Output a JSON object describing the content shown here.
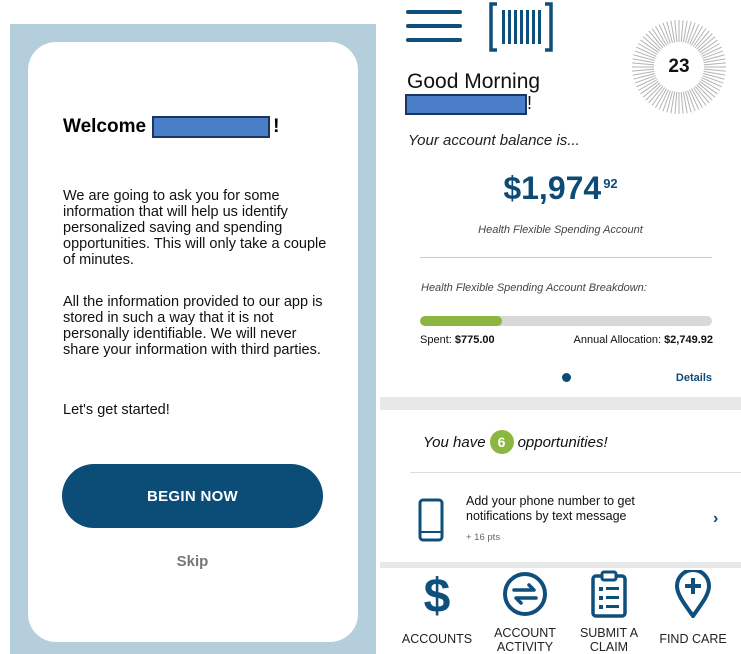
{
  "left": {
    "welcome_label": "Welcome",
    "welcome_punct": "!",
    "paragraph_1": "We are going to ask you for some information that will help us identify personalized saving and spending opportunities. This will only take a couple of minutes.",
    "paragraph_2": "All the information provided to our app is stored in such a way that it is not personally identifiable. We will never share your information with third parties.",
    "paragraph_3": "Let's get started!",
    "begin_button": "BEGIN NOW",
    "skip_link": "Skip"
  },
  "right": {
    "score": "23",
    "greeting": "Good Morning",
    "name_punct": "!",
    "balance_label": "Your account balance is...",
    "balance_dollars": "$1,974",
    "balance_cents": "92",
    "account_name": "Health Flexible Spending Account",
    "breakdown_title": "Health Flexible Spending Account Breakdown:",
    "spent_label": "Spent:",
    "spent_value": "$775.00",
    "annual_label": "Annual Allocation:",
    "annual_value": "$2,749.92",
    "spent_fraction": 0.282,
    "details_link": "Details",
    "opps_prefix": "You have",
    "opps_count": "6",
    "opps_suffix": "opportunities!",
    "task": {
      "title": "Add your phone number to get notifications by text message",
      "points": "+ 16 pts",
      "chevron": "›"
    },
    "nav": [
      {
        "label": "ACCOUNTS",
        "icon": "dollar-icon"
      },
      {
        "label": "ACCOUNT ACTIVITY",
        "icon": "swap-arrows-icon"
      },
      {
        "label": "SUBMIT A CLAIM",
        "icon": "clipboard-icon"
      },
      {
        "label": "FIND CARE",
        "icon": "map-pin-plus-icon"
      }
    ]
  },
  "colors": {
    "brand_blue": "#0d4b77",
    "accent_green": "#8bb640",
    "frame_blue": "#b4cfdb",
    "redaction": "#4a7ec9"
  }
}
